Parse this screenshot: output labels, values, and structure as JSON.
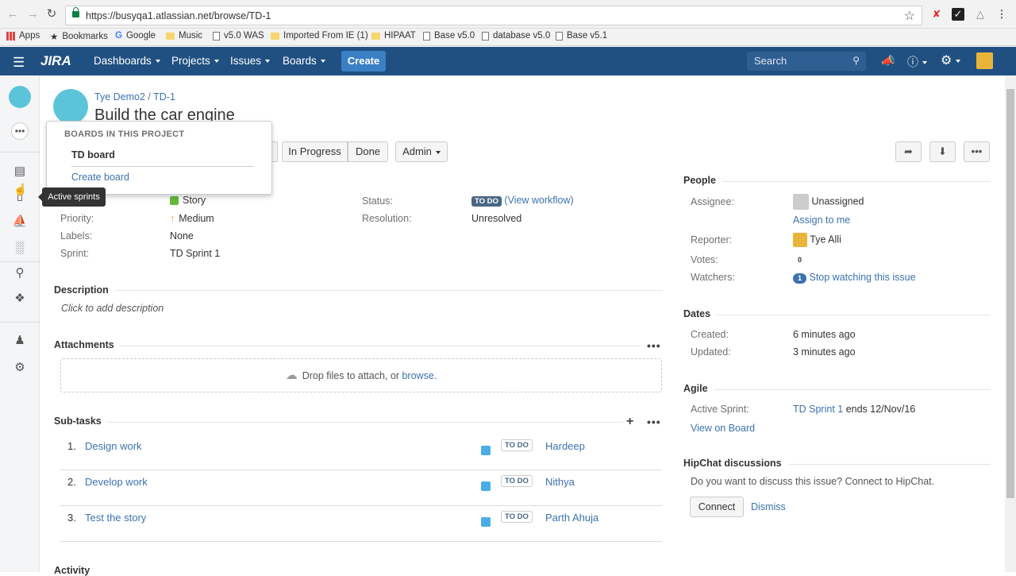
{
  "browser": {
    "url": "https://busyqa1.atlassian.net/browse/TD-1",
    "bookmarks": [
      "Apps",
      "Bookmarks",
      "Google",
      "Music",
      "v5.0 WAS",
      "Imported From IE (1)",
      "HIPAAT",
      "Base v5.0",
      "database v5.0",
      "Base v5.1"
    ]
  },
  "jira": {
    "logo": "JIRA",
    "nav": [
      "Dashboards",
      "Projects",
      "Issues",
      "Boards"
    ],
    "create": "Create",
    "search_placeholder": "Search"
  },
  "issue": {
    "project": "Tye Demo2",
    "key": "TD-1",
    "title": "Build the car engine",
    "workflow_buttons": [
      "In Progress",
      "Done",
      "Admin"
    ]
  },
  "boards_dropdown": {
    "heading": "BOARDS IN THIS PROJECT",
    "board": "TD board",
    "create": "Create board"
  },
  "tooltip": "Active sprints",
  "details": {
    "type_value": "Story",
    "priority_label": "Priority:",
    "priority_value": "Medium",
    "labels_label": "Labels:",
    "labels_value": "None",
    "sprint_label": "Sprint:",
    "sprint_value": "TD Sprint 1",
    "status_label": "Status:",
    "status_value": "TO DO",
    "workflow_link": "(View workflow)",
    "resolution_label": "Resolution:",
    "resolution_value": "Unresolved"
  },
  "description": {
    "heading": "Description",
    "placeholder": "Click to add description"
  },
  "attachments": {
    "heading": "Attachments",
    "drop_text": "Drop files to attach, or",
    "browse": "browse."
  },
  "subtasks": {
    "heading": "Sub-tasks",
    "rows": [
      {
        "num": "1.",
        "name": "Design work",
        "status": "TO DO",
        "assignee": "Hardeep"
      },
      {
        "num": "2.",
        "name": "Develop work",
        "status": "TO DO",
        "assignee": "Nithya"
      },
      {
        "num": "3.",
        "name": "Test the story",
        "status": "TO DO",
        "assignee": "Parth Ahuja"
      }
    ]
  },
  "activity": {
    "heading": "Activity"
  },
  "people": {
    "heading": "People",
    "assignee_label": "Assignee:",
    "assignee_value": "Unassigned",
    "assign_me": "Assign to me",
    "reporter_label": "Reporter:",
    "reporter_value": "Tye Alli",
    "votes_label": "Votes:",
    "votes_value": "0",
    "watchers_label": "Watchers:",
    "watchers_value": "1",
    "watch_link": "Stop watching this issue"
  },
  "dates": {
    "heading": "Dates",
    "created_label": "Created:",
    "created_value": "6 minutes ago",
    "updated_label": "Updated:",
    "updated_value": "3 minutes ago"
  },
  "agile": {
    "heading": "Agile",
    "sprint_label": "Active Sprint:",
    "sprint_link": "TD Sprint 1",
    "sprint_ends": "ends 12/Nov/16",
    "view_board": "View on Board"
  },
  "hipchat": {
    "heading": "HipChat discussions",
    "text": "Do you want to discuss this issue? Connect to HipChat.",
    "connect": "Connect",
    "dismiss": "Dismiss"
  },
  "colors": {
    "nav": "#205081",
    "link": "#3b73af",
    "create": "#3b7fc4"
  }
}
